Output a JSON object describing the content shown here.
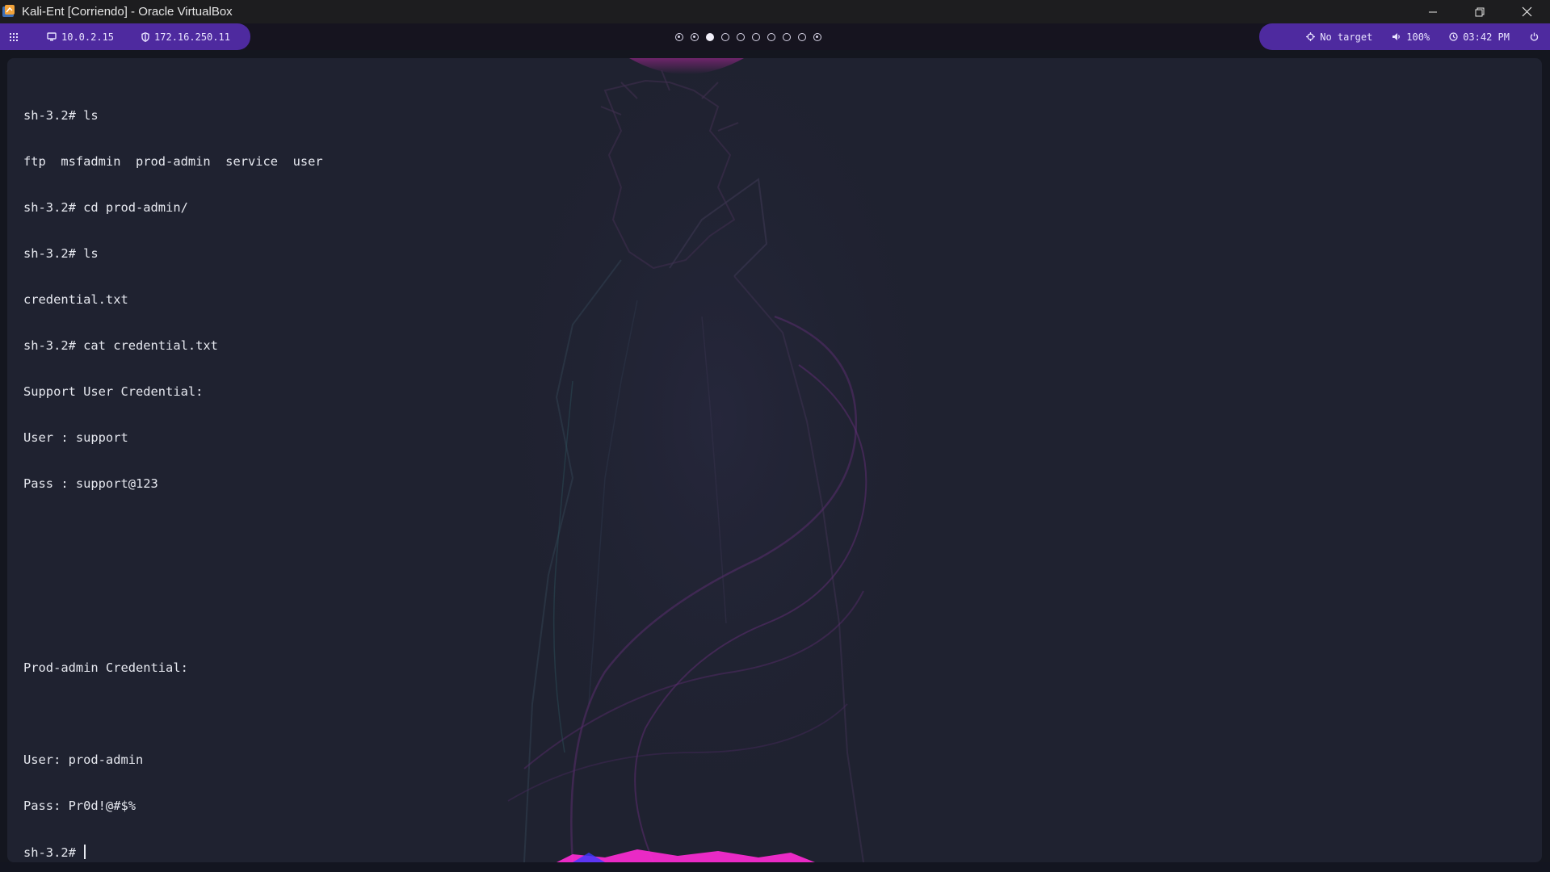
{
  "window": {
    "title": "Kali-Ent [Corriendo] - Oracle VirtualBox",
    "controls": [
      "minimize-icon",
      "restore-icon",
      "close-icon"
    ]
  },
  "topbar": {
    "menu_icon": "grid-icon",
    "local_ip": "10.0.2.15",
    "vpn_ip": "172.16.250.11",
    "workspaces": [
      {
        "state": "ring-dot"
      },
      {
        "state": "ring-dot"
      },
      {
        "state": "filled"
      },
      {
        "state": "empty"
      },
      {
        "state": "empty"
      },
      {
        "state": "empty"
      },
      {
        "state": "empty"
      },
      {
        "state": "empty"
      },
      {
        "state": "empty"
      },
      {
        "state": "ring-dot"
      }
    ],
    "target": "No target",
    "volume": "100%",
    "clock": "03:42 PM",
    "power_icon": "power-icon",
    "accent": "#4e2a9f"
  },
  "terminal": {
    "lines": [
      "sh-3.2# ls",
      "ftp  msfadmin  prod-admin  service  user",
      "sh-3.2# cd prod-admin/",
      "sh-3.2# ls",
      "credential.txt",
      "sh-3.2# cat credential.txt",
      "Support User Credential:",
      "User : support",
      "Pass : support@123",
      "",
      "",
      "",
      "Prod-admin Credential:",
      "",
      "User: prod-admin",
      "Pass: Pr0d!@#$%"
    ],
    "prompt": "sh-3.2# "
  }
}
